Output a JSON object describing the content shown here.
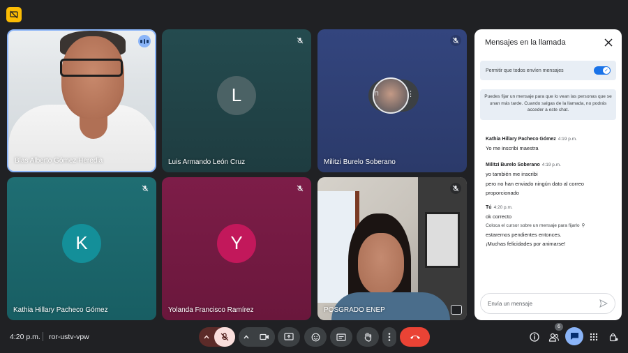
{
  "participants": [
    {
      "name": "Blas Alberto Gómez Heredia",
      "type": "video",
      "speaking": true
    },
    {
      "name": "Luis Armando León Cruz",
      "type": "avatar",
      "initial": "L",
      "avatar_color": "#4b6265",
      "muted": true
    },
    {
      "name": "Militzi Burelo Soberano",
      "type": "avatar-photo",
      "muted": true
    },
    {
      "name": "Kathia Hillary Pacheco Gómez",
      "type": "avatar",
      "initial": "K",
      "avatar_color": "#148f99",
      "muted": true
    },
    {
      "name": "Yolanda Francisco Ramírez",
      "type": "avatar",
      "initial": "Y",
      "avatar_color": "#c2185b",
      "muted": true
    },
    {
      "name": "POSGRADO ENEP",
      "type": "video",
      "muted": true
    }
  ],
  "chat": {
    "title": "Mensajes en la llamada",
    "allow_label": "Permitir que todos envíen mensajes",
    "allow_enabled": true,
    "info": "Puedes fijar un mensaje para que lo vean las personas que se unan más tarde. Cuando salgas de la llamada, no podrás acceder a este chat.",
    "messages": [
      {
        "sender": "Kathia Hillary Pacheco Gómez",
        "time": "4:19 p.m.",
        "lines": [
          "Yo me inscribi maestra"
        ]
      },
      {
        "sender": "Militzi Burelo Soberano",
        "time": "4:19 p.m.",
        "lines": [
          "yo también me inscribi",
          "pero no han enviado ningún dato al correo proporcionado"
        ]
      },
      {
        "sender": "Tú",
        "time": "4:20 p.m.",
        "lines": [
          "ok correcto"
        ],
        "hint": "Coloca el cursor sobre un mensaje para fijarlo",
        "more": [
          "estaremos pendientes entonces.",
          "¡Muchas felicidades por animarse!"
        ]
      }
    ],
    "input_placeholder": "Envía un mensaje"
  },
  "bottom": {
    "time": "4:20 p.m.",
    "meeting_code": "ror-ustv-vpw",
    "people_count": "6"
  },
  "colors": {
    "accent": "#8ab4f8",
    "end_call": "#ea4335",
    "background": "#202124"
  }
}
